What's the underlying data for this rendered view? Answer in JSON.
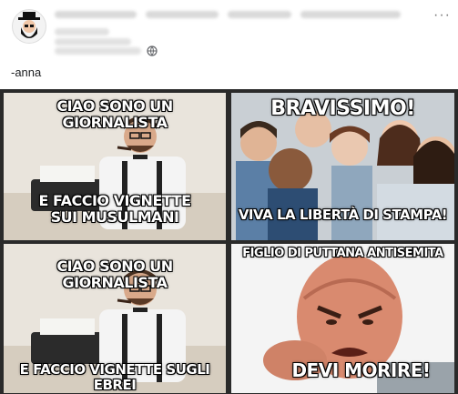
{
  "post": {
    "caption": "-anna",
    "more_label": "···"
  },
  "memes": {
    "p1": {
      "top": "CIAO SONO UN GIORNALISTA",
      "bottom": "E FACCIO VIGNETTE SUI MUSULMANI"
    },
    "p2": {
      "top": "BRAVISSIMO!",
      "bottom": "VIVA LA LIBERTÀ DI STAMPA!"
    },
    "p3": {
      "top": "CIAO SONO UN GIORNALISTA",
      "bottom": "E FACCIO VIGNETTE SUGLI EBREI"
    },
    "p4": {
      "top": "FIGLIO DI PUTTANA ANTISEMITA",
      "bottom": "DEVI MORIRE!"
    }
  },
  "icons": {
    "avatar": "bearded-hat-avatar-icon",
    "globe": "globe-icon",
    "more": "more-options-icon"
  }
}
